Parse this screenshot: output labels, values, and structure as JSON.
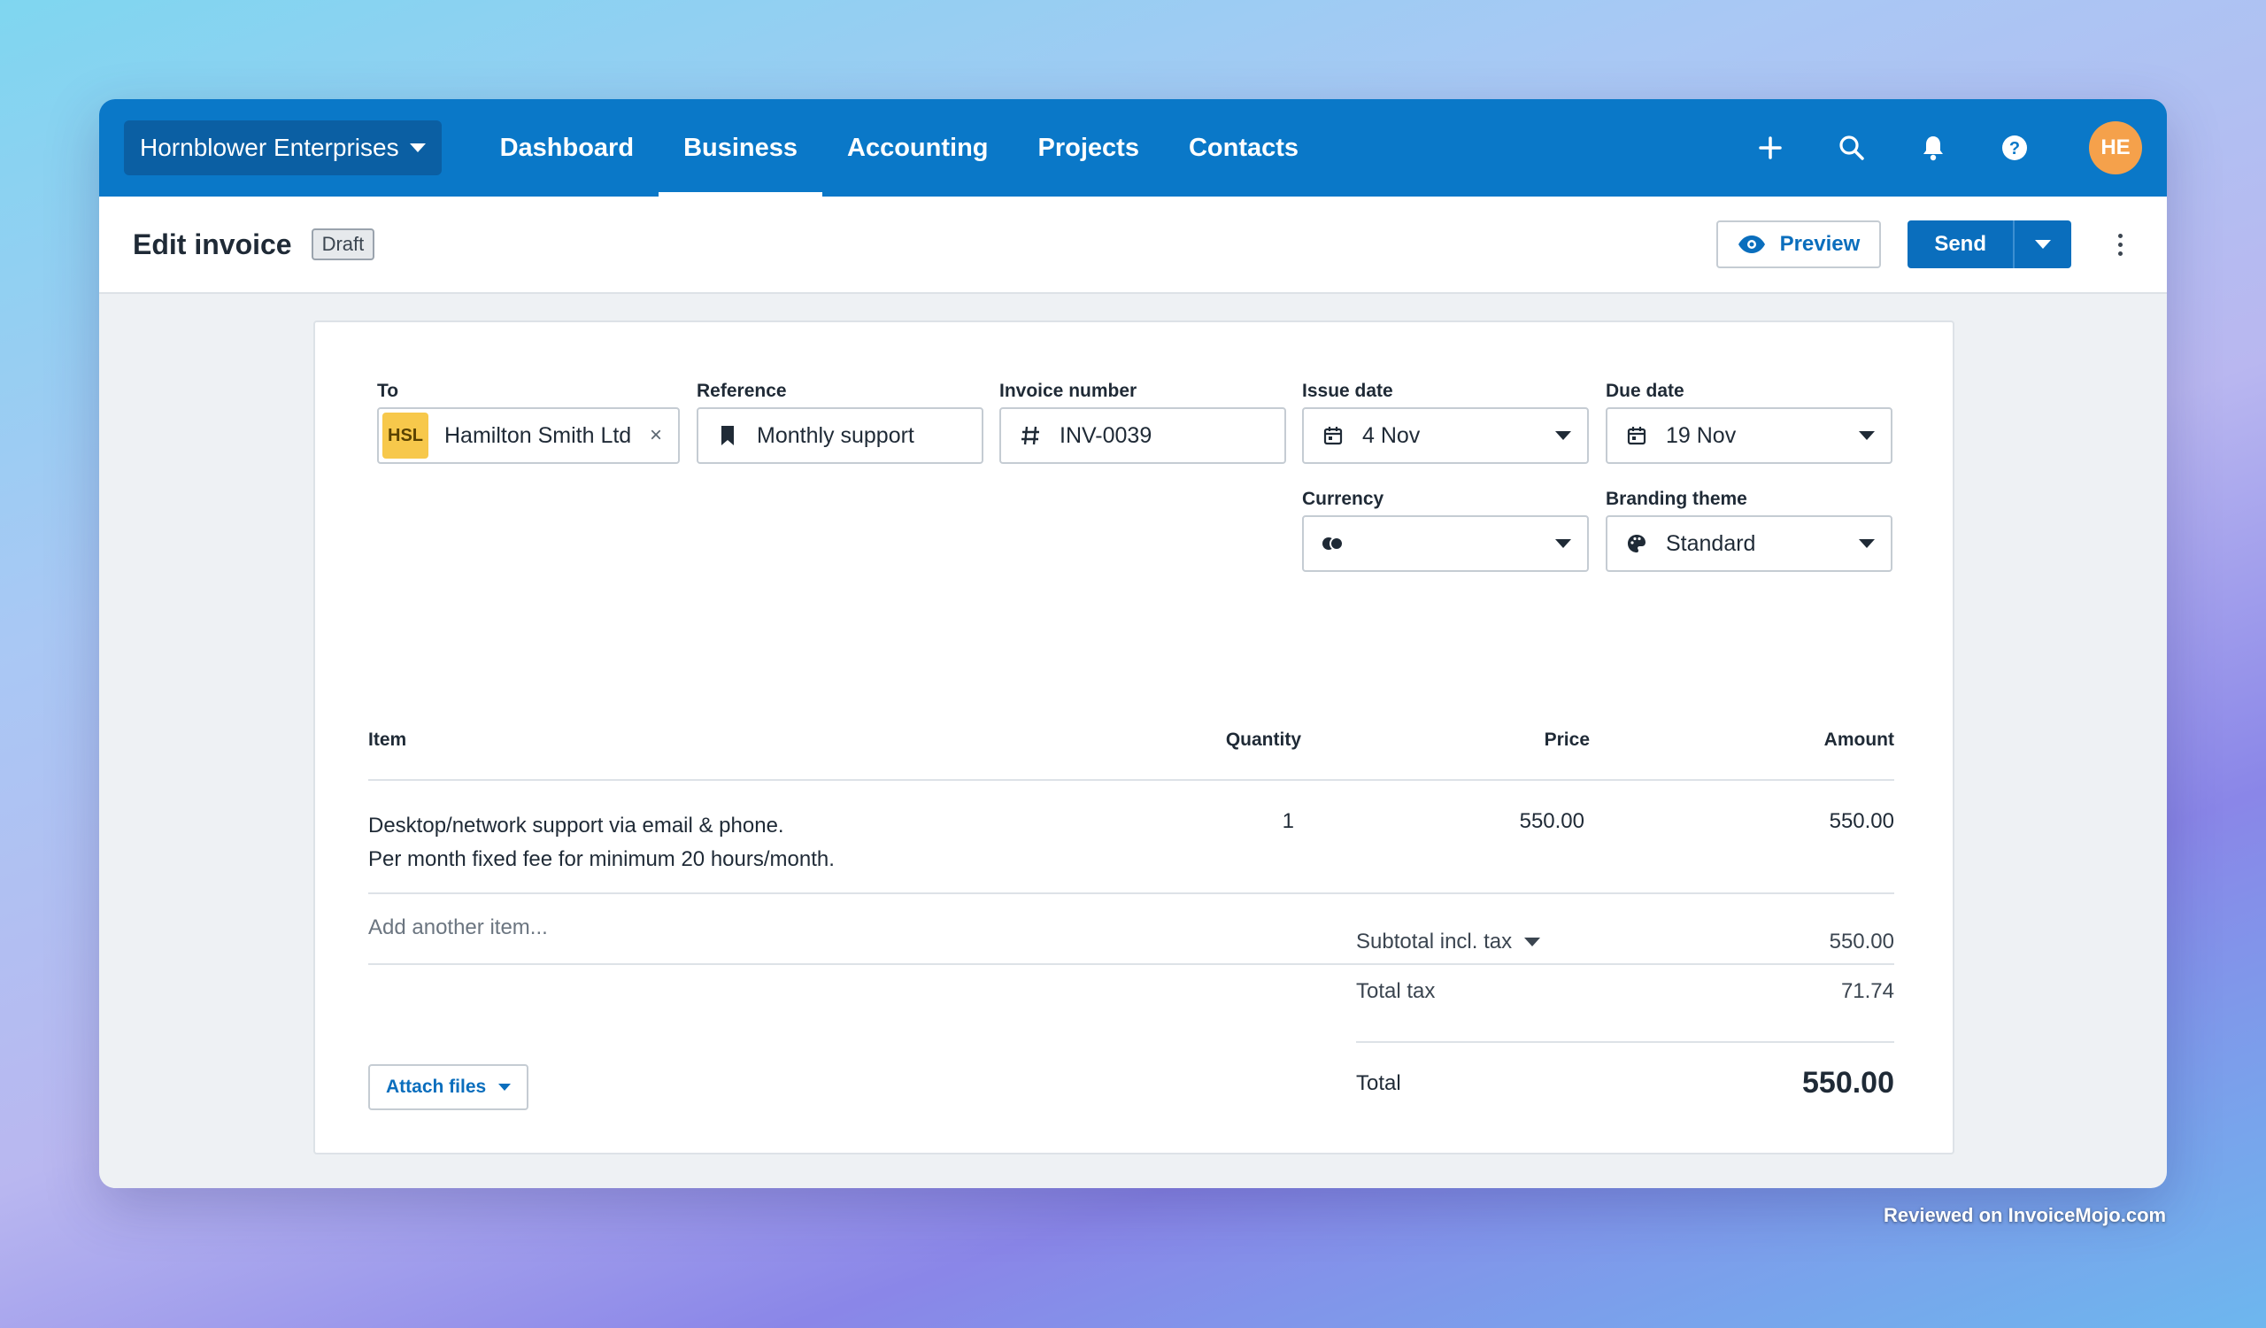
{
  "nav": {
    "org_name": "Hornblower Enterprises",
    "links": [
      "Dashboard",
      "Business",
      "Accounting",
      "Projects",
      "Contacts"
    ],
    "active": "Business",
    "icons": [
      "plus-icon",
      "search-icon",
      "bell-icon",
      "help-icon"
    ],
    "avatar_initials": "HE"
  },
  "subheader": {
    "title": "Edit invoice",
    "status_badge": "Draft",
    "preview_label": "Preview",
    "send_label": "Send"
  },
  "form": {
    "to": {
      "label": "To",
      "contact_badge": "HSL",
      "value": "Hamilton Smith Ltd"
    },
    "reference": {
      "label": "Reference",
      "value": "Monthly support"
    },
    "invoice_number": {
      "label": "Invoice number",
      "value": "INV-0039"
    },
    "issue_date": {
      "label": "Issue date",
      "value": "4 Nov"
    },
    "due_date": {
      "label": "Due date",
      "value": "19 Nov"
    },
    "currency": {
      "label": "Currency",
      "value": ""
    },
    "branding_theme": {
      "label": "Branding theme",
      "value": "Standard"
    }
  },
  "items_table": {
    "headers": {
      "item": "Item",
      "quantity": "Quantity",
      "price": "Price",
      "amount": "Amount"
    },
    "rows": [
      {
        "description_line1": "Desktop/network support via email & phone.",
        "description_line2": "Per month fixed fee for minimum 20 hours/month.",
        "quantity": "1",
        "price": "550.00",
        "amount": "550.00"
      }
    ],
    "add_item_placeholder": "Add another item..."
  },
  "totals": {
    "subtotal_label": "Subtotal incl. tax",
    "subtotal_value": "550.00",
    "tax_label": "Total tax",
    "tax_value": "71.74",
    "total_label": "Total",
    "total_value": "550.00"
  },
  "attach_files_label": "Attach files",
  "watermark": "Reviewed on InvoiceMojo.com",
  "colors": {
    "nav_bg": "#0a78c8",
    "primary": "#0a6ebd",
    "avatar": "#f5a14b",
    "contact_badge": "#f7c84b"
  }
}
